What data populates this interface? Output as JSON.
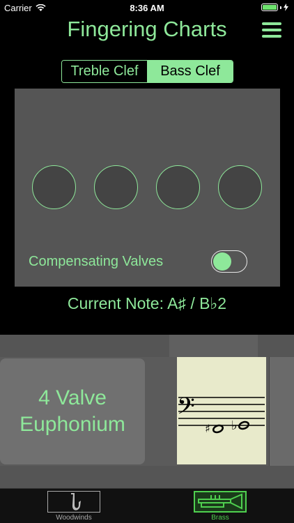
{
  "status_bar": {
    "carrier": "Carrier",
    "time": "8:36 AM"
  },
  "nav": {
    "title": "Fingering Charts",
    "menu_icon": "hamburger-icon"
  },
  "clef_segment": {
    "options": [
      "Treble Clef",
      "Bass Clef"
    ],
    "selected": "Bass Clef"
  },
  "valves": {
    "count": 4,
    "pressed": [
      false,
      false,
      false,
      false
    ]
  },
  "compensating": {
    "label": "Compensating Valves",
    "on": false
  },
  "current_note": "Current Note: A♯ / B♭2",
  "instrument": {
    "line1": "4 Valve",
    "line2": "Euphonium"
  },
  "staff": {
    "clef": "bass",
    "notes": [
      "A♯2",
      "B♭2"
    ]
  },
  "tabs": [
    {
      "label": "Woodwinds",
      "icon": "saxophone-icon",
      "selected": false
    },
    {
      "label": "Brass",
      "icon": "trumpet-icon",
      "selected": true
    }
  ],
  "colors": {
    "accent": "#8ee89a",
    "panel": "#555555",
    "background": "#000000"
  }
}
